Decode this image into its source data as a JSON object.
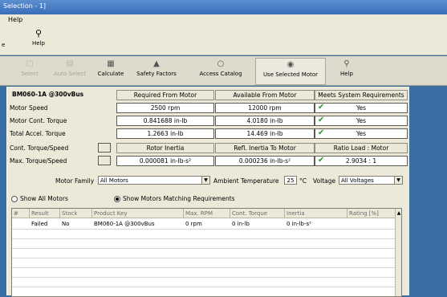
{
  "window": {
    "title": "Selection - 1]"
  },
  "menu": {
    "help": "Help"
  },
  "toolbar1": {
    "left_stub": "e",
    "help_label": "Help"
  },
  "toolbar2": [
    {
      "label": "Select",
      "icon": "select-icon",
      "disabled": true
    },
    {
      "label": "Auto Select",
      "icon": "auto-select-icon",
      "disabled": true
    },
    {
      "label": "Calculate",
      "icon": "calculator-icon",
      "disabled": false
    },
    {
      "label": "Safety Factors",
      "icon": "triangle-icon",
      "disabled": false
    },
    {
      "label": "Access Catalog",
      "icon": "radio-icon",
      "disabled": false
    },
    {
      "label": "Use Selected Motor",
      "icon": "radio-selected-icon",
      "disabled": false
    },
    {
      "label": "Help",
      "icon": "help-icon",
      "disabled": false
    }
  ],
  "motor_title": "BM060-1A @300vBus",
  "headers": {
    "required": "Required From Motor",
    "available": "Available From Motor",
    "meets": "Meets System Requirements",
    "rotor_inertia": "Rotor Inertia",
    "refl_inertia": "Refl. Inertia To Motor",
    "ratio": "Ratio Load : Motor"
  },
  "rows": [
    {
      "label": "Motor Speed",
      "required": "2500 rpm",
      "available": "12000 rpm",
      "meets": "Yes"
    },
    {
      "label": "Motor Cont. Torque",
      "required": "0.841688 in-lb",
      "available": "4.0180 in-lb",
      "meets": "Yes"
    },
    {
      "label": "Total Accel. Torque",
      "required": "1.2663 in-lb",
      "available": "14.469 in-lb",
      "meets": "Yes"
    }
  ],
  "cont_torque_speed": "Cont. Torque/Speed",
  "max_row": {
    "label": "Max. Torque/Speed",
    "rotor_inertia": "0.000081 in-lb-s²",
    "refl_inertia": "0.000236 in-lb-s²",
    "ratio": "2.9034 : 1"
  },
  "filters": {
    "motor_family_label": "Motor Family",
    "motor_family": "All Motors",
    "ambient_label": "Ambient Temperature",
    "ambient_value": "25",
    "ambient_unit": "°C",
    "voltage_label": "Voltage",
    "voltage": "All Voltages"
  },
  "radios": {
    "show_all": "Show All Motors",
    "show_matching": "Show Motors Matching Requirements"
  },
  "grid": {
    "columns": [
      "#",
      "Result",
      "Stock",
      "Product Key",
      "Max. RPM",
      "Cont. Torque",
      "Inertia",
      "Rating [%]"
    ],
    "rows": [
      [
        "",
        "Failed",
        "No",
        "BM060-1A @300vBus",
        "0 rpm",
        "0 in-lb",
        "0 in-lb-s²",
        ""
      ]
    ]
  }
}
